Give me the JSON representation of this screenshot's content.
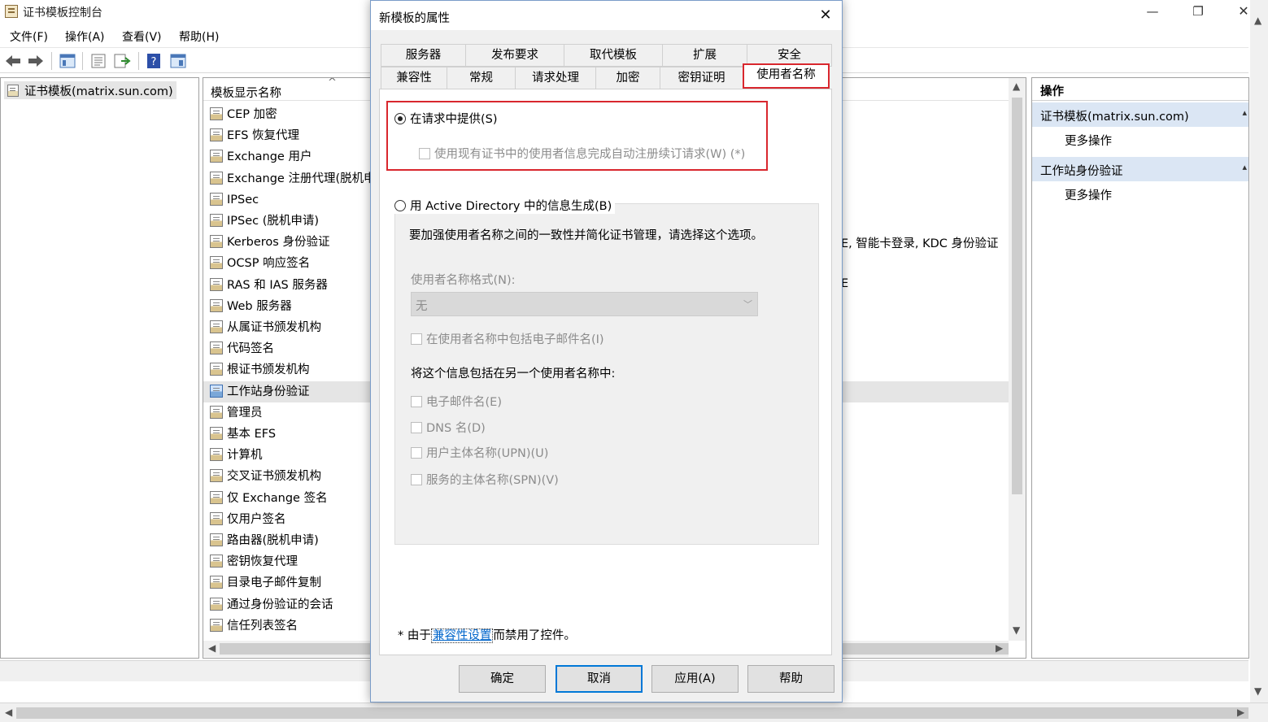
{
  "app": {
    "title": "证书模板控制台"
  },
  "menu": [
    "文件(F)",
    "操作(A)",
    "查看(V)",
    "帮助(H)"
  ],
  "toolbar_icons": [
    "back-arrow-icon",
    "forward-arrow-icon",
    "show-tree-icon",
    "properties-icon",
    "export-list-icon",
    "help-icon",
    "console-icon"
  ],
  "tree": {
    "root_label": "证书模板(matrix.sun.com)"
  },
  "list": {
    "column_header": "模板显示名称",
    "rows": [
      "CEP 加密",
      "EFS 恢复代理",
      "Exchange 用户",
      "Exchange 注册代理(脱机申",
      "IPSec",
      "IPSec (脱机申请)",
      "Kerberos 身份验证",
      "OCSP 响应签名",
      "RAS 和 IAS 服务器",
      "Web 服务器",
      "从属证书颁发机构",
      "代码签名",
      "根证书颁发机构",
      "工作站身份验证",
      "管理员",
      "基本 EFS",
      "计算机",
      "交叉证书颁发机构",
      "仅 Exchange 签名",
      "仅用户签名",
      "路由器(脱机申请)",
      "密钥恢复代理",
      "目录电子邮件复制",
      "通过身份验证的会话",
      "信任列表签名"
    ],
    "selected_row": "工作站身份验证",
    "trailing_text_kerberos": "E, 智能卡登录, KDC 身份验证",
    "trailing_text_ras": "E"
  },
  "actions": {
    "title": "操作",
    "groups": [
      {
        "label": "证书模板(matrix.sun.com)",
        "link": "更多操作"
      },
      {
        "label": "工作站身份验证",
        "link": "更多操作"
      }
    ]
  },
  "dialog": {
    "title": "新模板的属性",
    "tabs_row1": [
      "服务器",
      "发布要求",
      "取代模板",
      "扩展",
      "安全"
    ],
    "tabs_row2": [
      "兼容性",
      "常规",
      "请求处理",
      "加密",
      "密钥证明",
      "使用者名称"
    ],
    "active_tab": "使用者名称",
    "option_supply": "在请求中提供(S)",
    "option_supply_checked": true,
    "checkbox_reuse": "使用现有证书中的使用者信息完成自动注册续订请求(W) (*)",
    "option_ad": "用 Active Directory 中的信息生成(B)",
    "option_ad_checked": false,
    "ad_description": "要加强使用者名称之间的一致性并简化证书管理，请选择这个选项。",
    "name_format_label": "使用者名称格式(N):",
    "name_format_value": "无",
    "include_email": "在使用者名称中包括电子邮件名(I)",
    "alt_name_heading": "将这个信息包括在另一个使用者名称中:",
    "alt_options": [
      "电子邮件名(E)",
      "DNS 名(D)",
      "用户主体名称(UPN)(U)",
      "服务的主体名称(SPN)(V)"
    ],
    "footnote_prefix": "* 由于",
    "footnote_link": "兼容性设置",
    "footnote_suffix": "而禁用了控件。",
    "buttons": {
      "ok": "确定",
      "cancel": "取消",
      "apply": "应用(A)",
      "help": "帮助"
    }
  },
  "colors": {
    "highlight_red": "#d9272e",
    "action_group_bg": "#dbe6f4",
    "default_button_border": "#0078d7"
  }
}
